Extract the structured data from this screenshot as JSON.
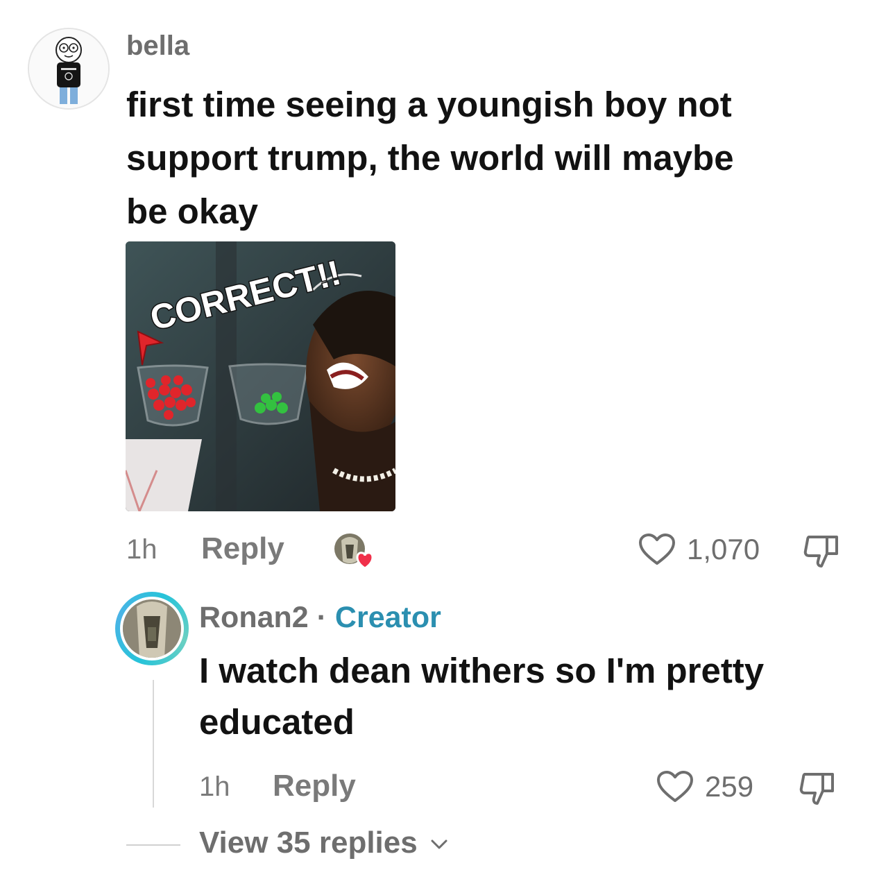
{
  "comment": {
    "username": "bella",
    "text_lines": [
      "first time seeing a youngish boy not",
      "support trump, the world will maybe",
      "be okay"
    ],
    "image": {
      "caption_text": "CORRECT!!"
    },
    "time": "1h",
    "reply_label": "Reply",
    "like_count": "1,070",
    "creator_liked": true
  },
  "reply": {
    "username": "Ronan2",
    "separator": " · ",
    "badge": "Creator",
    "text_lines": [
      "I watch dean withers so I'm pretty",
      "educated"
    ],
    "time": "1h",
    "reply_label": "Reply",
    "like_count": "259"
  },
  "view_replies": {
    "label": "View 35 replies"
  },
  "colors": {
    "accent_creator": "#2b8fb0",
    "heart_red": "#f0304a",
    "muted_text": "#7a7a7a"
  },
  "icons": [
    "heart-outline-icon",
    "dislike-icon",
    "chevron-down-icon",
    "creator-heart-badge-icon"
  ]
}
